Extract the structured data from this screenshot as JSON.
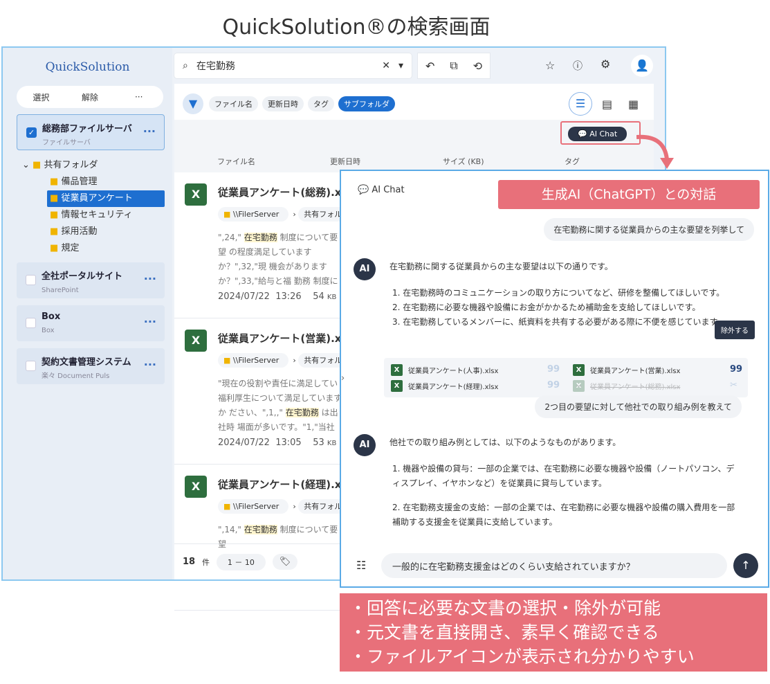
{
  "title": "QuickSolution®の検索画面",
  "sidebar": {
    "logo": "QuickSolution",
    "select": "選択",
    "release": "解除",
    "more": "···",
    "sources": [
      {
        "name": "総務部ファイルサーバ",
        "type": "ファイルサーバ",
        "checked": true
      },
      {
        "name": "全社ポータルサイト",
        "type": "SharePoint",
        "checked": false
      },
      {
        "name": "Box",
        "type": "Box",
        "checked": false
      },
      {
        "name": "契約文書管理システム",
        "type": "楽々 Document Puls",
        "checked": false
      }
    ],
    "tree": {
      "root": "共有フォルダ",
      "children": [
        "備品管理",
        "従業員アンケート",
        "情報セキュリティ",
        "採用活動",
        "規定"
      ],
      "selected": "従業員アンケート"
    }
  },
  "search": {
    "query": "在宅勤務"
  },
  "filters": [
    "ファイル名",
    "更新日時",
    "タグ",
    "サブフォルダ"
  ],
  "ai_chat_button": "AI Chat",
  "columns": [
    "ファイル名",
    "更新日時",
    "サイズ (KB)",
    "タグ"
  ],
  "results": [
    {
      "name": "従業員アンケート(総務).xlsx",
      "server": "\\\\FilerServer",
      "folder": "共有フォルダ",
      "snippet_pre": "\",24,\" ",
      "hl": "在宅勤務",
      "snippet_post": " 制度について要望 の程度満足していますか？\",32,\"現 機会がありますか？\",33,\"給与と福 勤務 制度について要望を教えてく",
      "date": "2024/07/22",
      "time": "13:26",
      "size": "54",
      "unit": "KB"
    },
    {
      "name": "従業員アンケート(営業).xlsx",
      "server": "\\\\FilerServer",
      "folder": "共有フォルダ",
      "snippet_pre": "\"現在の役割や責任に満足してい 福利厚生について満足していますか ださい、\",1,,\" ",
      "hl": "在宅勤務",
      "snippet_post": " は出社時 場面が多いです。\"1,\"当社での働",
      "date": "2024/07/22",
      "time": "13:05",
      "size": "53",
      "unit": "KB"
    },
    {
      "name": "従業員アンケート(経理).xlsx",
      "server": "\\\\FilerServer",
      "folder": "共有フォルダ",
      "snippet_pre": "\",14,\" ",
      "hl": "在宅勤務",
      "snippet_post": " 制度について要望",
      "date": "",
      "time": "",
      "size": "",
      "unit": ""
    }
  ],
  "footer": {
    "count": "18",
    "count_unit": "件",
    "range": "1 － 10"
  },
  "chat": {
    "title": "AI Chat",
    "q1": "在宅勤務に関する従業員からの主な要望を列挙して",
    "a1_intro": "在宅勤務に関する従業員からの主な要望は以下の通りです。",
    "a1_items": [
      "1. 在宅勤務時のコミュニケーションの取り方についてなど、研修を整備してほしいです。",
      "2. 在宅勤務に必要な機器や設備にお金がかかるため補助金を支給してほしいです。",
      "3. 在宅勤務しているメンバーに、紙資料を共有する必要がある際に不便を感じています。"
    ],
    "refs": [
      "従業員アンケート(人事).xlsx",
      "従業員アンケート(営業).xlsx",
      "従業員アンケート(経理).xlsx",
      "従業員アンケート(総務).xlsx"
    ],
    "tooltip": "除外する",
    "q2": "2つ目の要望に対して他社での取り組み例を教えて",
    "a2_intro": "他社での取り組み例としては、以下のようなものがあります。",
    "a2_items": [
      "1. 機器や設備の貸与：一部の企業では、在宅勤務に必要な機器や設備（ノートパソコン、ディスプレイ、イヤホンなど）を従業員に貸与しています。",
      "2. 在宅勤務支援金の支給：一部の企業では、在宅勤務に必要な機器や設備の購入費用を一部補助する支援金を従業員に支給しています。"
    ],
    "input": "一般的に在宅勤務支援金はどのくらい支給されていますか？"
  },
  "callout_top": "生成AI（ChatGPT）との対話",
  "callout_bottom": [
    "・回答に必要な文書の選択・除外が可能",
    "・元文書を直接開き、素早く確認できる",
    "・ファイルアイコンが表示され分かりやすい"
  ],
  "colors": {
    "accent": "#1e6fd0",
    "callout": "#e8707a",
    "excel": "#2e6e3e"
  }
}
